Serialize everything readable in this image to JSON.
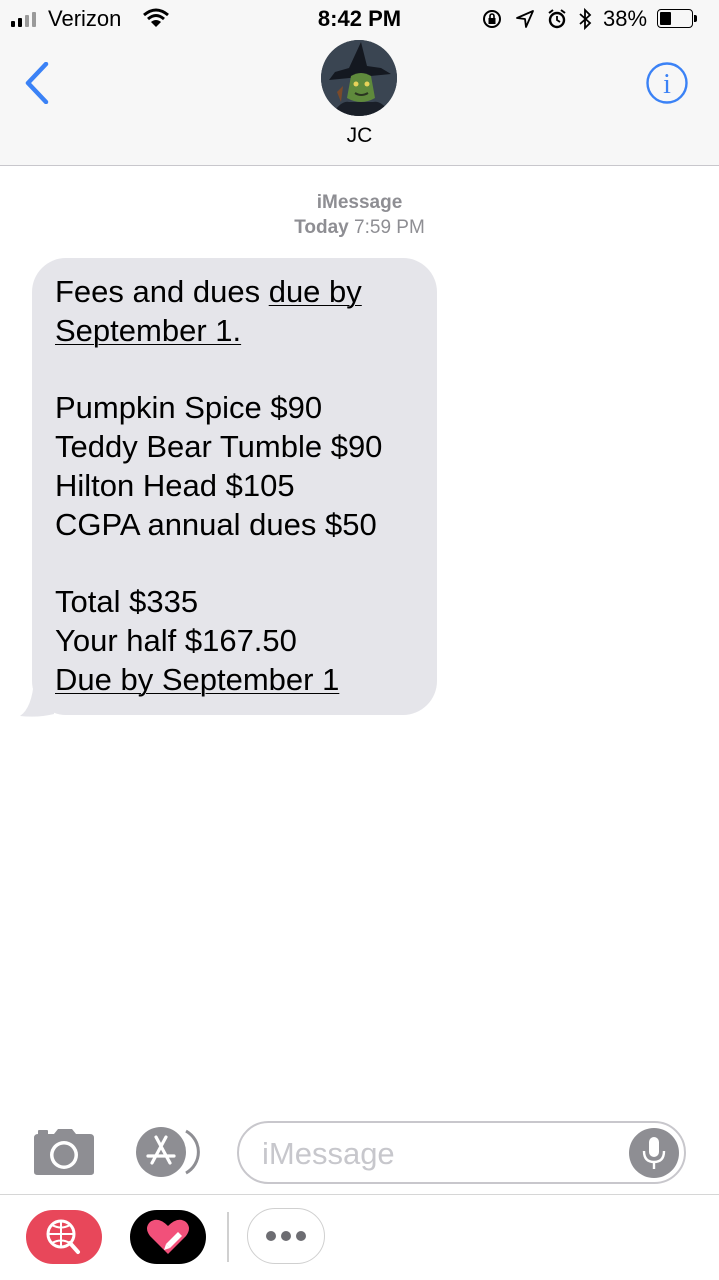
{
  "status_bar": {
    "carrier": "Verizon",
    "time": "8:42 PM",
    "battery_percent": "38%",
    "battery_level": 0.38,
    "signal_bars": 4,
    "icons": [
      "wifi-icon",
      "orientation-lock-icon",
      "location-icon",
      "alarm-icon",
      "bluetooth-icon",
      "battery-icon"
    ]
  },
  "header": {
    "back_icon": "chevron-left-icon",
    "contact_name": "JC",
    "info_icon": "info-icon"
  },
  "conversation": {
    "service": "iMessage",
    "timestamp_day": "Today",
    "timestamp_time": "7:59 PM",
    "message": {
      "lines": [
        "Fees and dues ",
        "due by",
        "September 1.",
        "",
        "Pumpkin Spice $90",
        "Teddy Bear Tumble $90",
        "Hilton Head $105",
        "CGPA annual dues $50",
        "",
        "Total $335",
        "Your half $167.50",
        "Due by September 1"
      ]
    }
  },
  "compose": {
    "placeholder": "iMessage",
    "camera_icon": "camera-icon",
    "apps_icon": "app-store-icon",
    "mic_icon": "microphone-icon"
  },
  "app_drawer": {
    "apps": [
      "search-images-app-icon",
      "digital-touch-heart-icon",
      "more-apps-icon"
    ]
  },
  "colors": {
    "accent_blue": "#3b82f6",
    "bubble_gray": "#e5e5ea",
    "secondary_text": "#8e8e93",
    "search_app_red": "#e8475a"
  }
}
